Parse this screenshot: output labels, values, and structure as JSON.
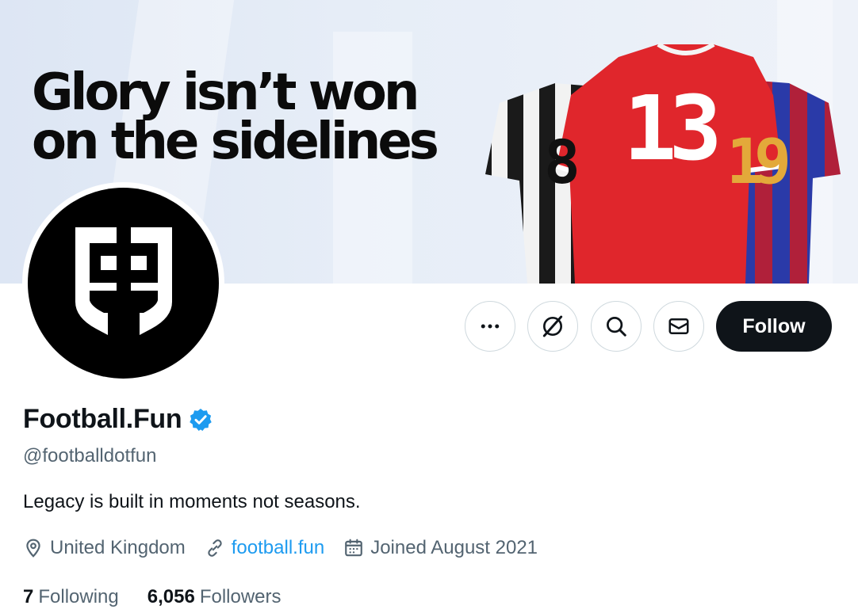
{
  "banner": {
    "headline_line1": "Glory isn’t won",
    "headline_line2": "on the sidelines",
    "jersey_numbers": [
      "8",
      "13",
      "19"
    ]
  },
  "avatar": {
    "icon": "football-fun-shield-logo"
  },
  "actions": {
    "more_icon": "more-horizontal-icon",
    "grok_icon": "grok-icon",
    "search_icon": "search-icon",
    "message_icon": "envelope-icon",
    "follow_label": "Follow"
  },
  "profile": {
    "display_name": "Football.Fun",
    "verified": true,
    "handle": "@footballdotfun",
    "bio": "Legacy is built in moments not seasons.",
    "location": "United Kingdom",
    "website": "football.fun",
    "joined": "Joined August 2021"
  },
  "stats": {
    "following_count": "7",
    "following_label": "Following",
    "followers_count": "6,056",
    "followers_label": "Followers"
  },
  "colors": {
    "accent": "#1d9bf0",
    "text_primary": "#0f1419",
    "text_secondary": "#536471",
    "follow_bg": "#0f1419"
  }
}
